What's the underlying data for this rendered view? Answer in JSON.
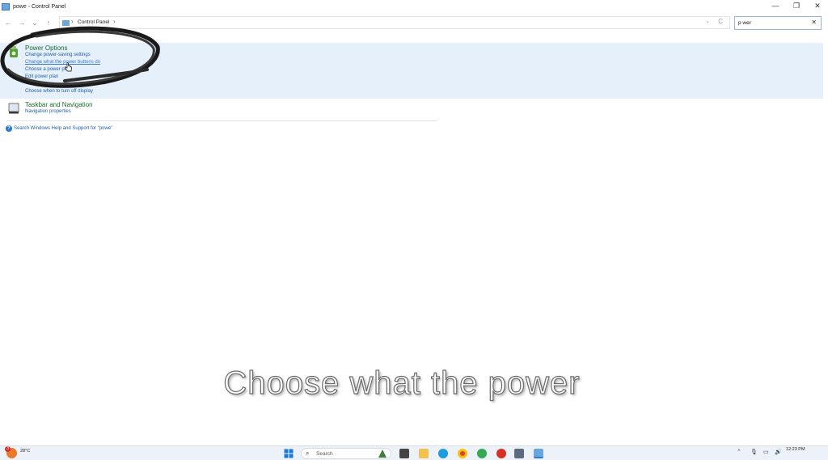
{
  "window": {
    "title": "powe - Control Panel",
    "minimize_glyph": "—",
    "restore_glyph": "❐",
    "close_glyph": "✕"
  },
  "navigation": {
    "back_glyph": "←",
    "forward_glyph": "→",
    "recent_glyph": "⌄",
    "up_glyph": "↑",
    "breadcrumb": [
      "Control Panel"
    ],
    "search_value": "p wer",
    "search_clear": "✕",
    "refresh_glyph": "C",
    "dropdown_glyph": "⌄"
  },
  "results": [
    {
      "group": "Power Options",
      "icon": "power-options-icon",
      "links": [
        "Change power-saving settings",
        "Change what the power buttons do",
        "Choose a power plan",
        "Edit power plan",
        "Choose when to turn off display"
      ]
    },
    {
      "group": "Taskbar and Navigation",
      "icon": "taskbar-icon",
      "links": [
        "Navigation properties"
      ]
    }
  ],
  "help_link": "Search Windows Help and Support for \"powe\"",
  "caption": "Choose what the power",
  "taskbar": {
    "weather_temp": "28°C",
    "weather_badge": "3",
    "search_placeholder": "Search",
    "clock_time": "12:23 PM",
    "accent": "#2a78d6"
  }
}
